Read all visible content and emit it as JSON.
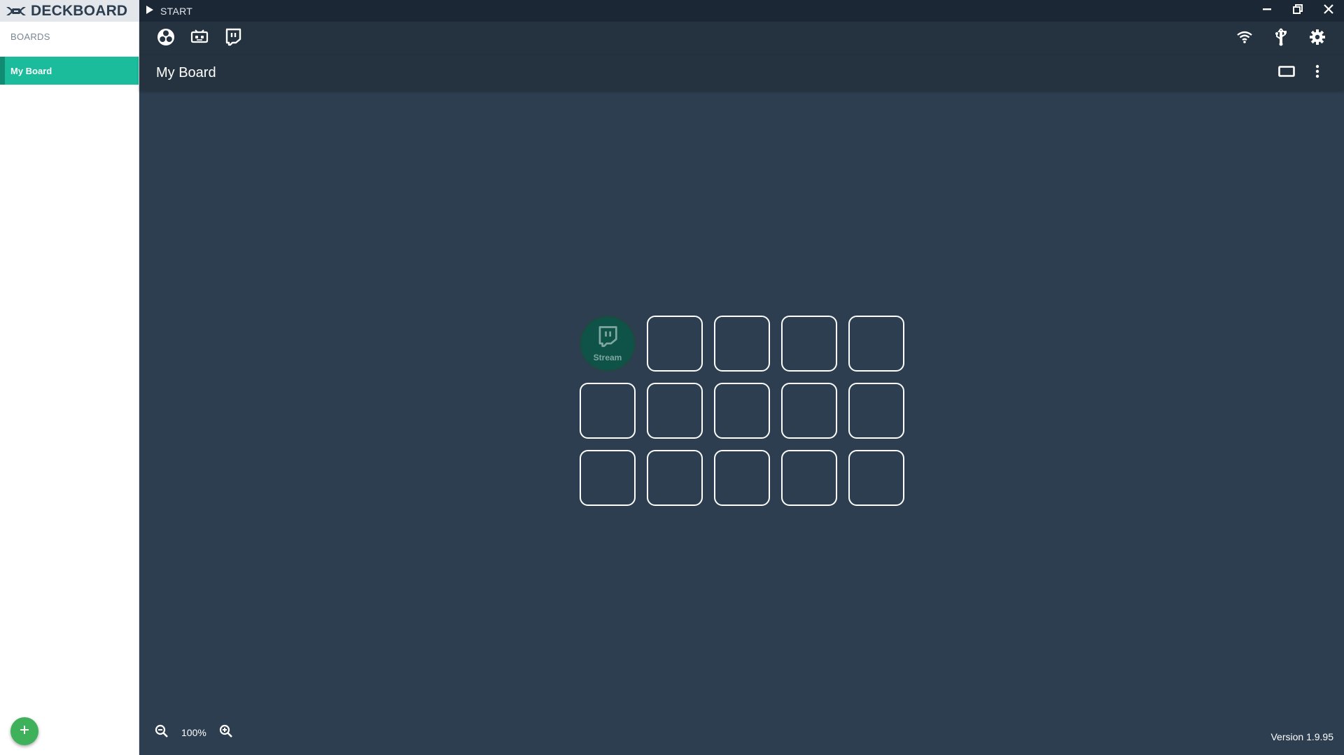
{
  "brand": {
    "name": "DECKBOARD"
  },
  "titlebar": {
    "start_label": "START"
  },
  "sidebar": {
    "section_label": "BOARDS",
    "boards": [
      {
        "label": "My Board",
        "active": true
      }
    ]
  },
  "toolbar": {
    "left_icons": [
      "obs-icon",
      "streamlabs-icon",
      "twitch-icon"
    ],
    "right_icons": [
      "wifi-icon",
      "usb-icon",
      "gear-icon"
    ]
  },
  "board": {
    "title": "My Board",
    "grid": {
      "columns": 5,
      "rows": 3
    },
    "buttons": [
      {
        "label": "Stream",
        "icon": "twitch-icon",
        "color": "#0e5248"
      }
    ]
  },
  "footer": {
    "zoom": "100%",
    "version": "Version 1.9.95"
  },
  "colors": {
    "accent": "#1abc9c",
    "background": "#2d3e50",
    "add_button": "#3fb15b"
  }
}
